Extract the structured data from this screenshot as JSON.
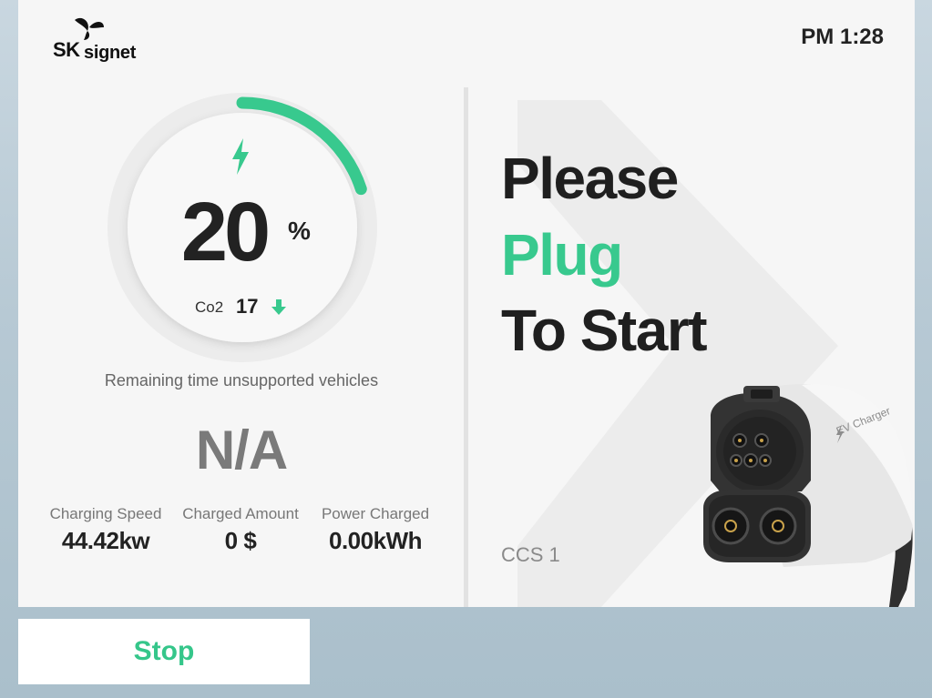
{
  "brand": {
    "sk": "SK",
    "signet": "signet"
  },
  "clock": "PM 1:28",
  "charge": {
    "percent_value": "20",
    "percent_sign": "%",
    "percent_fraction": 0.2,
    "co2_label": "Co2",
    "co2_value": "17"
  },
  "remaining_label": "Remaining time  unsupported vehicles",
  "remaining_value": "N/A",
  "stats": [
    {
      "label": "Charging Speed",
      "value": "44.42kw"
    },
    {
      "label": "Charged Amount",
      "value": "0 $"
    },
    {
      "label": "Power Charged",
      "value": "0.00kWh"
    }
  ],
  "message": {
    "line1": "Please",
    "line2": "Plug",
    "line3": "To Start"
  },
  "connector": {
    "type": "CCS 1",
    "handle_label": "EV Charger"
  },
  "stop_label": "Stop",
  "colors": {
    "accent": "#38c98e",
    "panel": "#f6f6f6",
    "text": "#222222"
  },
  "icons": {
    "charge": "lightning-bolt-icon",
    "co2_trend": "arrow-down-icon"
  }
}
